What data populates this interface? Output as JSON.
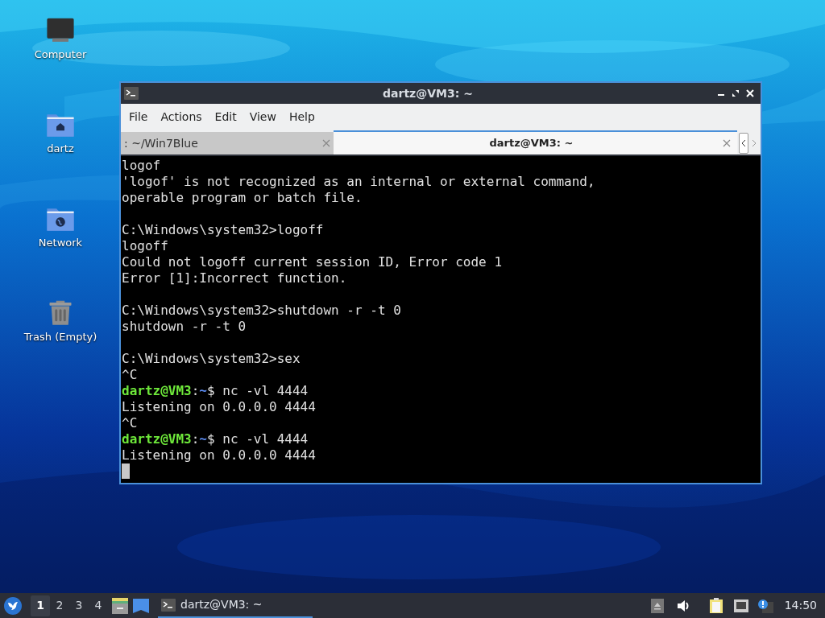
{
  "desktop_icons": [
    {
      "kind": "computer",
      "label": "Computer"
    },
    {
      "kind": "home",
      "label": "dartz"
    },
    {
      "kind": "network",
      "label": "Network"
    },
    {
      "kind": "trash",
      "label": "Trash (Empty)"
    }
  ],
  "window": {
    "title": "dartz@VM3: ~",
    "menu": [
      "File",
      "Actions",
      "Edit",
      "View",
      "Help"
    ],
    "tabs": [
      {
        "label": ": ~/Win7Blue",
        "selected": false
      },
      {
        "label": "dartz@VM3: ~",
        "selected": true
      }
    ],
    "lines": [
      {
        "kind": "text",
        "text": "logof"
      },
      {
        "kind": "text",
        "text": "'logof' is not recognized as an internal or external command,"
      },
      {
        "kind": "text",
        "text": "operable program or batch file."
      },
      {
        "kind": "blank"
      },
      {
        "kind": "text",
        "text": "C:\\Windows\\system32>logoff"
      },
      {
        "kind": "text",
        "text": "logoff"
      },
      {
        "kind": "text",
        "text": "Could not logoff current session ID, Error code 1"
      },
      {
        "kind": "text",
        "text": "Error [1]:Incorrect function."
      },
      {
        "kind": "blank"
      },
      {
        "kind": "text",
        "text": "C:\\Windows\\system32>shutdown -r -t 0"
      },
      {
        "kind": "text",
        "text": "shutdown -r -t 0"
      },
      {
        "kind": "blank"
      },
      {
        "kind": "text",
        "text": "C:\\Windows\\system32>sex"
      },
      {
        "kind": "text",
        "text": "^C"
      },
      {
        "kind": "prompt",
        "user_host": "dartz@VM3",
        "sep": ":",
        "path": "~",
        "command": "$ nc -vl 4444"
      },
      {
        "kind": "text",
        "text": "Listening on 0.0.0.0 4444"
      },
      {
        "kind": "text",
        "text": "^C"
      },
      {
        "kind": "prompt",
        "user_host": "dartz@VM3",
        "sep": ":",
        "path": "~",
        "command": "$ nc -vl 4444"
      },
      {
        "kind": "text",
        "text": "Listening on 0.0.0.0 4444"
      },
      {
        "kind": "cursor"
      }
    ]
  },
  "taskbar": {
    "workspaces": [
      {
        "label": "1",
        "selected": true
      },
      {
        "label": "2",
        "selected": false
      },
      {
        "label": "3",
        "selected": false
      },
      {
        "label": "4",
        "selected": false
      }
    ],
    "tasks": [
      {
        "label": "dartz@VM3: ~",
        "selected": true
      }
    ],
    "clock": "14:50"
  }
}
